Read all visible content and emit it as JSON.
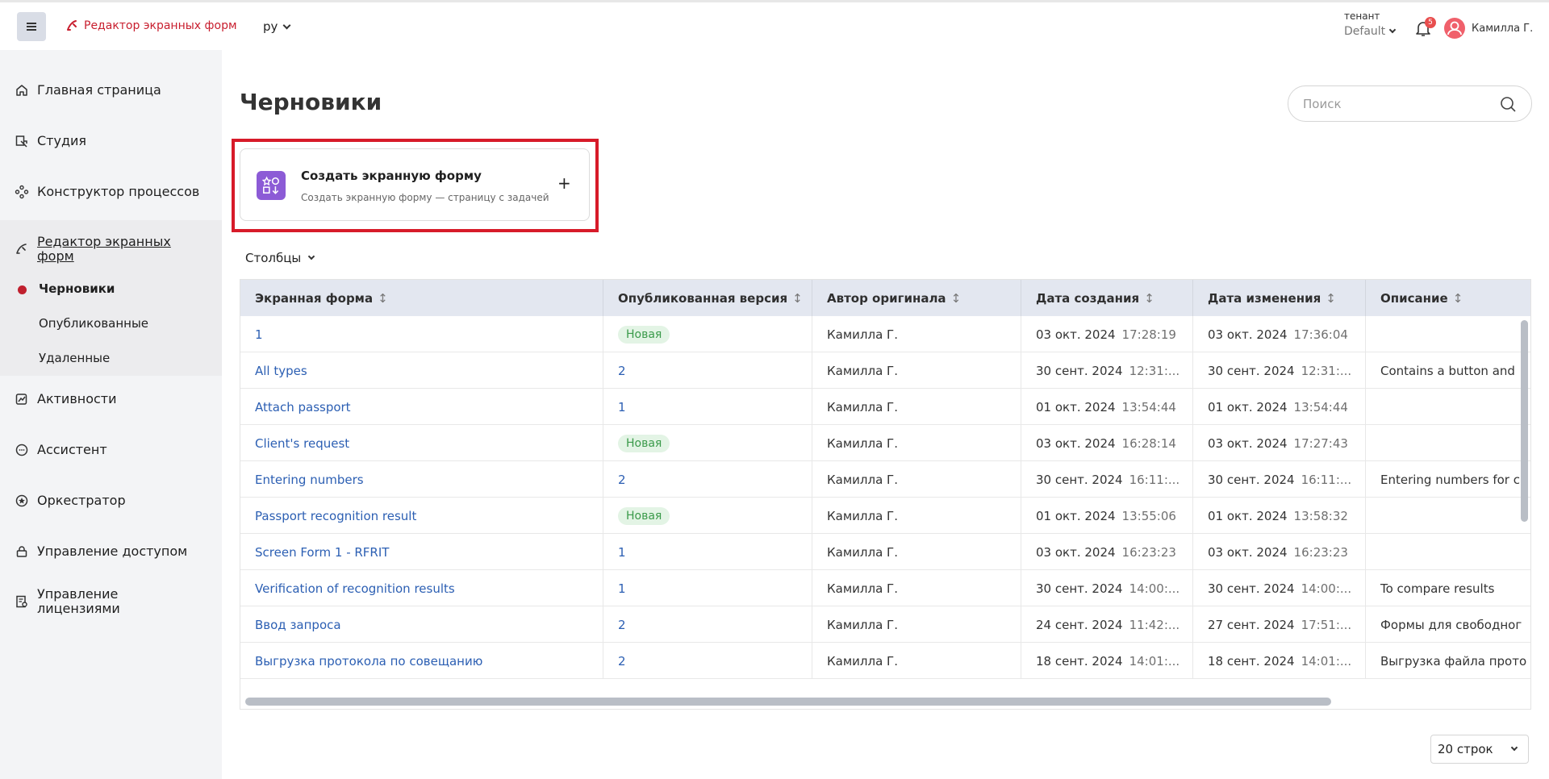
{
  "header": {
    "brand": "Редактор экранных форм",
    "lang": "ру",
    "tenant_label": "тенант",
    "tenant_value": "Default",
    "notifications_count": "5",
    "user_name": "Камилла Г."
  },
  "sidebar": {
    "items": [
      {
        "label": "Главная страница",
        "icon": "home-icon"
      },
      {
        "label": "Студия",
        "icon": "studio-icon"
      },
      {
        "label": "Конструктор процессов",
        "icon": "process-icon"
      },
      {
        "label": "Редактор экранных форм",
        "icon": "form-editor-icon"
      },
      {
        "label": "Активности",
        "icon": "activity-icon"
      },
      {
        "label": "Ассистент",
        "icon": "assistant-icon"
      },
      {
        "label": "Оркестратор",
        "icon": "orchestrator-icon"
      },
      {
        "label": "Управление доступом",
        "icon": "lock-icon"
      },
      {
        "label": "Управление лицензиями",
        "icon": "license-icon"
      }
    ],
    "sub_items": [
      "Черновики",
      "Опубликованные",
      "Удаленные"
    ]
  },
  "main": {
    "title": "Черновики",
    "search_placeholder": "Поиск",
    "create_card": {
      "title": "Создать экранную форму",
      "subtitle": "Создать экранную форму — страницу с задачей",
      "plus": "+"
    },
    "columns_label": "Столбцы",
    "rows_per_page": "20 строк"
  },
  "table": {
    "sort_glyph": "↕",
    "headers": [
      "Экранная форма",
      "Опубликованная версия",
      "Автор оригинала",
      "Дата создания",
      "Дата изменения",
      "Описание"
    ],
    "rows": [
      {
        "name": "1",
        "version": "Новая",
        "author": "Камилла Г.",
        "created_date": "03 окт. 2024",
        "created_time": "17:28:19",
        "modified_date": "03 окт. 2024",
        "modified_time": "17:36:04",
        "description": ""
      },
      {
        "name": "All types",
        "version": "2",
        "author": "Камилла Г.",
        "created_date": "30 сент. 2024",
        "created_time": "12:31:...",
        "modified_date": "30 сент. 2024",
        "modified_time": "12:31:...",
        "description": "Contains a button and"
      },
      {
        "name": "Attach passport",
        "version": "1",
        "author": "Камилла Г.",
        "created_date": "01 окт. 2024",
        "created_time": "13:54:44",
        "modified_date": "01 окт. 2024",
        "modified_time": "13:54:44",
        "description": ""
      },
      {
        "name": "Client's request",
        "version": "Новая",
        "author": "Камилла Г.",
        "created_date": "03 окт. 2024",
        "created_time": "16:28:14",
        "modified_date": "03 окт. 2024",
        "modified_time": "17:27:43",
        "description": ""
      },
      {
        "name": "Entering numbers",
        "version": "2",
        "author": "Камилла Г.",
        "created_date": "30 сент. 2024",
        "created_time": "16:11:...",
        "modified_date": "30 сент. 2024",
        "modified_time": "16:11:...",
        "description": "Entering numbers for c"
      },
      {
        "name": "Passport recognition result",
        "version": "Новая",
        "author": "Камилла Г.",
        "created_date": "01 окт. 2024",
        "created_time": "13:55:06",
        "modified_date": "01 окт. 2024",
        "modified_time": "13:58:32",
        "description": ""
      },
      {
        "name": "Screen Form 1 - RFRIT",
        "version": "1",
        "author": "Камилла Г.",
        "created_date": "03 окт. 2024",
        "created_time": "16:23:23",
        "modified_date": "03 окт. 2024",
        "modified_time": "16:23:23",
        "description": ""
      },
      {
        "name": "Verification of recognition results",
        "version": "1",
        "author": "Камилла Г.",
        "created_date": "30 сент. 2024",
        "created_time": "14:00:...",
        "modified_date": "30 сент. 2024",
        "modified_time": "14:00:...",
        "description": "To compare results"
      },
      {
        "name": "Ввод запроса",
        "version": "2",
        "author": "Камилла Г.",
        "created_date": "24 сент. 2024",
        "created_time": "11:42:...",
        "modified_date": "27 сент. 2024",
        "modified_time": "17:51:...",
        "description": "Формы для свободног"
      },
      {
        "name": "Выгрузка протокола по совещанию",
        "version": "2",
        "author": "Камилла Г.",
        "created_date": "18 сент. 2024",
        "created_time": "14:01:...",
        "modified_date": "18 сент. 2024",
        "modified_time": "14:01:...",
        "description": "Выгрузка файла прото"
      }
    ]
  }
}
